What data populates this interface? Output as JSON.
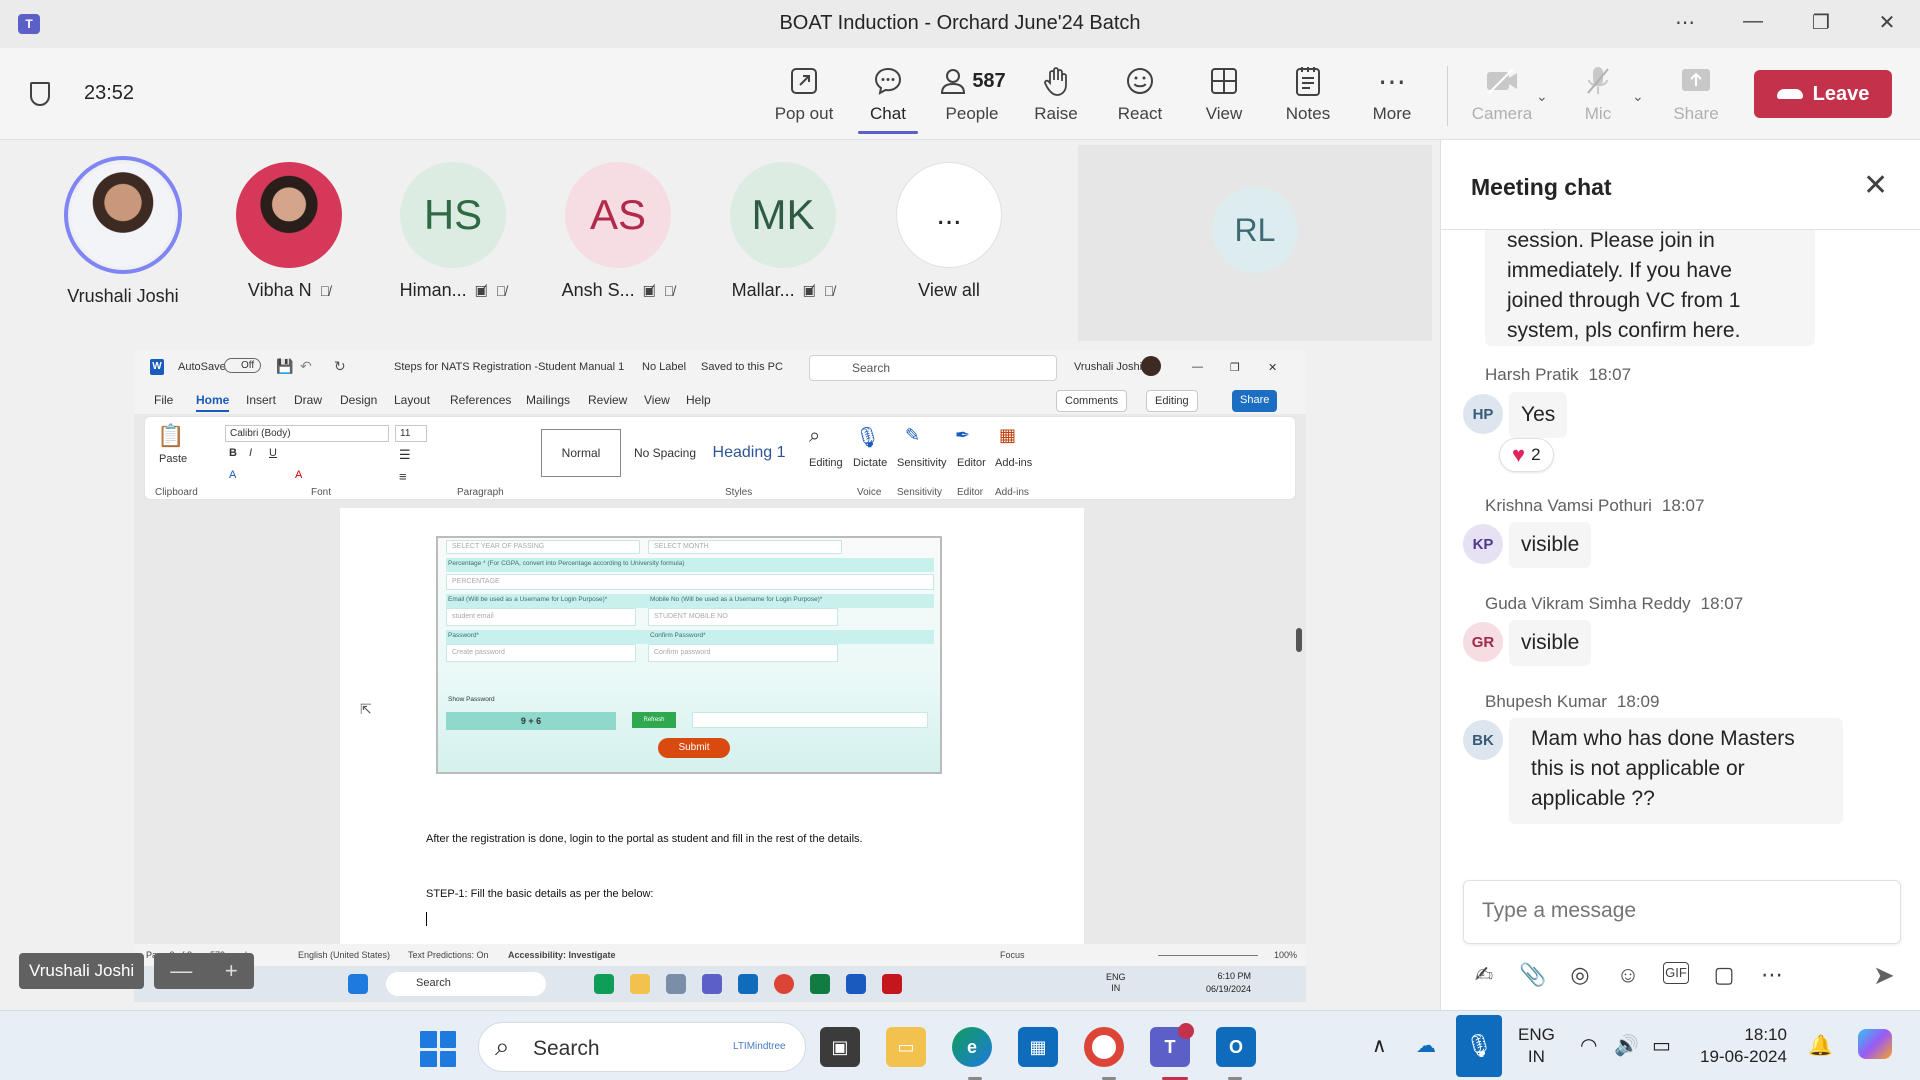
{
  "window": {
    "title": "BOAT Induction - Orchard June'24 Batch",
    "controls": [
      "more-icon",
      "minimize-icon",
      "restore-icon",
      "close-icon"
    ]
  },
  "toolbar": {
    "timer": "23:52",
    "pop_out": "Pop out",
    "chat": "Chat",
    "people_count": "587",
    "people": "People",
    "raise": "Raise",
    "react": "React",
    "view": "View",
    "notes": "Notes",
    "more": "More",
    "camera": "Camera",
    "mic": "Mic",
    "share": "Share",
    "leave": "Leave"
  },
  "participants": [
    {
      "name": "Vrushali Joshi",
      "initials": ""
    },
    {
      "name": "Vibha N",
      "initials": ""
    },
    {
      "name": "Himan...",
      "initials": "HS"
    },
    {
      "name": "Ansh S...",
      "initials": "AS"
    },
    {
      "name": "Mallar...",
      "initials": "MK"
    },
    {
      "name": "View all",
      "initials": "..."
    }
  ],
  "large_tile_initials": "RL",
  "speaker_tag": "Vrushali Joshi",
  "word": {
    "autosave": "AutoSave",
    "autosave_state": "Off",
    "doc_title": "Steps for NATS Registration -Student Manual 1",
    "label_status": "No Label",
    "saved": "Saved to this PC",
    "search": "Search",
    "user": "Vrushali Joshi",
    "menu": [
      "File",
      "Home",
      "Insert",
      "Draw",
      "Design",
      "Layout",
      "References",
      "Mailings",
      "Review",
      "View",
      "Help"
    ],
    "comments": "Comments",
    "editing": "Editing",
    "share": "Share",
    "font": "Calibri (Body)",
    "font_size": "11",
    "paste": "Paste",
    "styles": [
      "Normal",
      "No Spacing",
      "Heading 1"
    ],
    "editing_group": "Editing",
    "dictate": "Dictate",
    "sensitivity": "Sensitivity",
    "editor": "Editor",
    "addins": "Add-ins",
    "groups": [
      "Clipboard",
      "Font",
      "Paragraph",
      "Styles",
      "Voice",
      "Sensitivity",
      "Editor",
      "Add-ins"
    ],
    "form": {
      "year": "SELECT YEAR OF PASSING",
      "month": "SELECT MONTH",
      "percentage_label": "Percentage * (For CGPA, convert into Percentage according to University formula)",
      "percentage": "PERCENTAGE",
      "email_label": "Email (Will be used as a Username for Login Purpose)*",
      "email": "student email",
      "mobile_label": "Mobile No (Will be used as a Username for Login Purpose)*",
      "mobile": "STUDENT MOBILE NO",
      "password_label": "Password*",
      "password": "Create password",
      "confirm_label": "Confirm Password*",
      "confirm": "Confirm password",
      "show_password": "Show Password",
      "captcha": "9 + 6",
      "refresh": "Refresh",
      "submit": "Submit"
    },
    "para1": "After the registration is done, login to the portal as student and fill in the rest of the details.",
    "para2": "STEP-1: Fill the basic details as per the below:",
    "status": {
      "page": "Page 3 of 8",
      "words": "573 words",
      "language": "English (United States)",
      "predictions": "Text Predictions: On",
      "accessibility": "Accessibility: Investigate",
      "focus": "Focus",
      "zoom": "100%"
    },
    "inner_taskbar": {
      "search": "Search",
      "lang": "ENG",
      "region": "IN",
      "time": "6:10 PM",
      "date": "06/19/2024"
    }
  },
  "chat": {
    "title": "Meeting chat",
    "messages": [
      {
        "author": "",
        "time": "",
        "text": "session. Please join in immediately. If you have joined through VC from 1 system, pls confirm here."
      },
      {
        "author": "Harsh Pratik",
        "time": "18:07",
        "initials": "HP",
        "text": "Yes",
        "reaction_count": "2"
      },
      {
        "author": "Krishna Vamsi Pothuri",
        "time": "18:07",
        "initials": "KP",
        "text": "visible"
      },
      {
        "author": "Guda Vikram Simha Reddy",
        "time": "18:07",
        "initials": "GR",
        "text": "visible"
      },
      {
        "author": "Bhupesh Kumar",
        "time": "18:09",
        "initials": "BK",
        "text": "Mam who has done Masters this is not applicable or applicable ??"
      }
    ],
    "compose_placeholder": "Type a message"
  },
  "taskbar": {
    "search": "Search",
    "search_logo": "LTIMindtree",
    "lang": "ENG",
    "region": "IN",
    "time": "18:10",
    "date": "19-06-2024"
  },
  "colors": {
    "accent": "#5b5fc7",
    "leave": "#c4314b",
    "word_blue": "#185abd"
  }
}
